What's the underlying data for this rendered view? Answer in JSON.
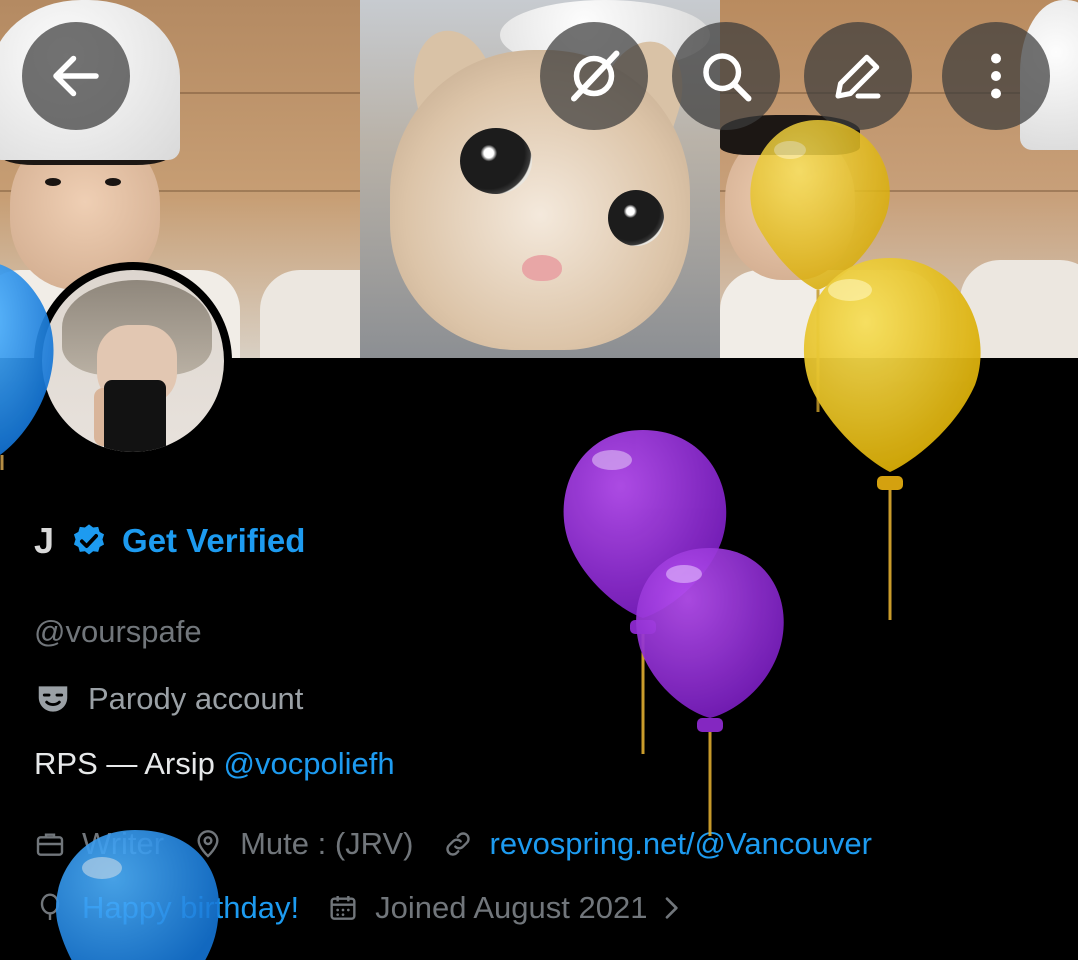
{
  "profile": {
    "display_name": "J",
    "get_verified_label": "Get Verified",
    "handle": "@vourspafe",
    "parody_label": "Parody account",
    "bio_text": "RPS — Arsip ",
    "bio_mention": "@vocpoliefh",
    "job": "Writer",
    "location": "Mute : (JRV)",
    "website": "revospring.net/@Vancouver",
    "birthday": "Happy birthday!",
    "joined": "Joined August 2021"
  },
  "header": {
    "back_icon": "arrow-left-icon",
    "grok_icon": "grok-icon",
    "search_icon": "search-icon",
    "edit_icon": "pencil-icon",
    "more_icon": "more-vertical-icon"
  },
  "colors": {
    "accent": "#1d9bf0",
    "secondary_text": "#71767b",
    "balloon_yellow": "#e8c11a",
    "balloon_purple": "#9b2fd8",
    "balloon_blue": "#1d8fe8"
  }
}
